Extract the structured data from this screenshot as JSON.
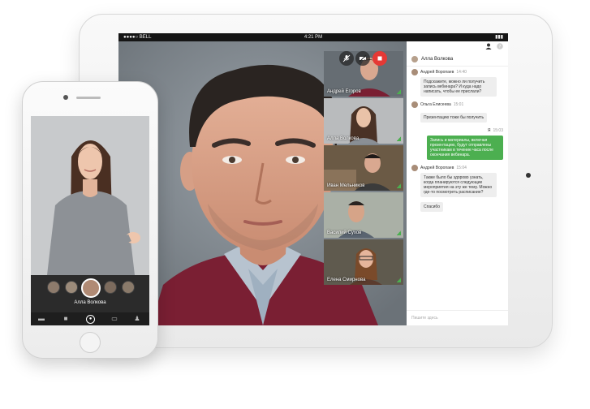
{
  "status_bar": {
    "carrier": "●●●●○ BELL",
    "time": "4:21 PM",
    "battery": "▮▮▮"
  },
  "tablet": {
    "controls": [
      {
        "name": "mute-mic-button",
        "glyph": "🎤"
      },
      {
        "name": "camera-off-button",
        "glyph": "⊘"
      },
      {
        "name": "stop-call-button",
        "glyph": "■"
      }
    ],
    "participants": [
      {
        "name": "Андрей Егоров"
      },
      {
        "name": "Алла Волкова"
      },
      {
        "name": "Иван Мельников"
      },
      {
        "name": "Василий Сухов"
      },
      {
        "name": "Елена Смирнова"
      }
    ],
    "chat": {
      "contact": "Алла Волкова",
      "messages": [
        {
          "author": "Андрей Воропаев",
          "time": "14:40",
          "text": "Подскажите, можно ли получить запись вебинара? И куда надо написать, чтобы ее прислали?",
          "mine": false
        },
        {
          "author": "Ольга Елисеева",
          "time": "15:01",
          "text": "Презентацию тоже бы получить",
          "mine": false
        },
        {
          "author": "Я",
          "time": "15:03",
          "text": "Запись и материалы, включая презентацию, будут отправлены участникам в течение часа после окончания вебинара.",
          "mine": true
        },
        {
          "author": "Андрей Воропаев",
          "time": "15:04",
          "text": "Также было бы здорово узнать, когда планируются следующие мероприятия на эту же тему. Можно где-то посмотреть расписание?",
          "mine": false
        },
        {
          "author": "",
          "time": "",
          "text": "Спасибо",
          "mine": false,
          "continuation": true
        }
      ],
      "input_placeholder": "Пишите здесь"
    }
  },
  "phone": {
    "active_speaker": "Алла Волкова",
    "nav": [
      {
        "name": "files-nav-icon",
        "glyph": "▬"
      },
      {
        "name": "video-nav-icon",
        "glyph": "■"
      },
      {
        "name": "record-nav-icon",
        "glyph": "●"
      },
      {
        "name": "chat-nav-icon",
        "glyph": "▭"
      },
      {
        "name": "participants-nav-icon",
        "glyph": "♟"
      }
    ]
  },
  "colors": {
    "accent_green": "#4caf50",
    "stop_red": "#e53935",
    "chat_bg": "#ffffff",
    "strip_bg": "#2b2b2b"
  }
}
